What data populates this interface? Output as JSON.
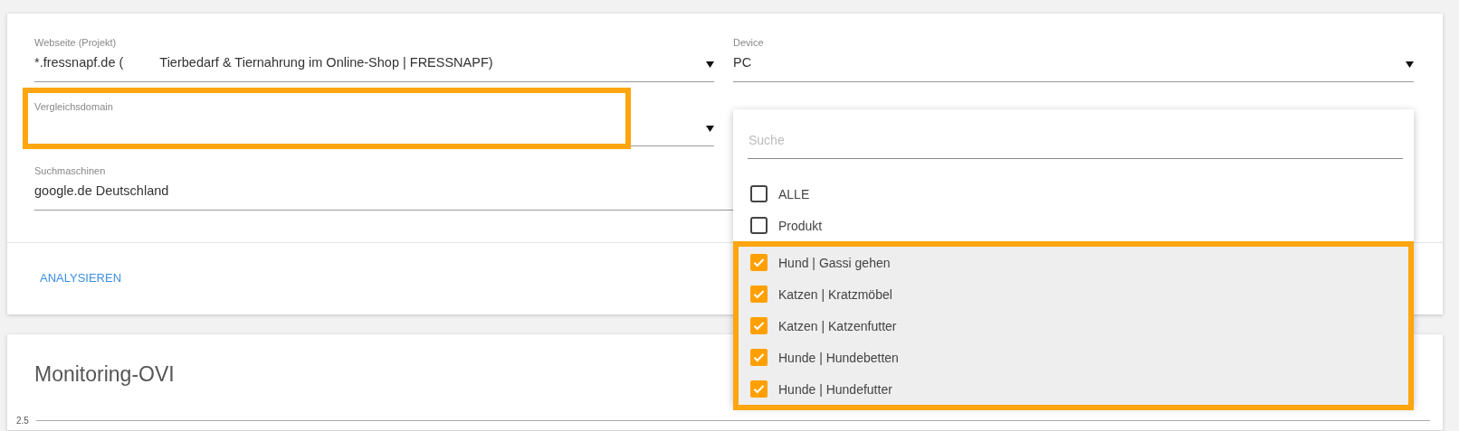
{
  "form": {
    "fields": [
      {
        "kind": "select",
        "label": "Webseite (Projekt)",
        "value": "*.fressnapf.de (",
        "value_detail": "Tierbedarf & Tiernahrung im Online-Shop | FRESSNAPF)",
        "highlighted": false
      },
      {
        "kind": "select",
        "label": "Device",
        "value": "PC",
        "highlighted": false
      },
      {
        "kind": "select",
        "label": "Vergleichsdomain",
        "highlighted": true
      },
      {
        "kind": "multiselect"
      },
      {
        "kind": "text",
        "label": "Suchmaschinen",
        "value": "google.de Deutschland",
        "highlighted": false
      }
    ],
    "dropdown": {
      "search_placeholder": "Suche",
      "options": [
        {
          "label": "ALLE",
          "checked": false,
          "highlighted": false
        },
        {
          "label": "Produkt",
          "checked": false,
          "highlighted": false
        },
        {
          "label": "Hund | Gassi gehen",
          "checked": true,
          "highlighted": true
        },
        {
          "label": "Katzen | Kratzmöbel",
          "checked": true,
          "highlighted": true
        },
        {
          "label": "Katzen | Katzenfutter",
          "checked": true,
          "highlighted": true
        },
        {
          "label": "Hunde | Hundebetten",
          "checked": true,
          "highlighted": true
        },
        {
          "label": "Hunde | Hundefutter",
          "checked": true,
          "highlighted": true
        }
      ]
    },
    "action": "ANALYSIEREN"
  },
  "monitoring": {
    "title": "Monitoring-OVI",
    "y_tick": "2.5"
  }
}
